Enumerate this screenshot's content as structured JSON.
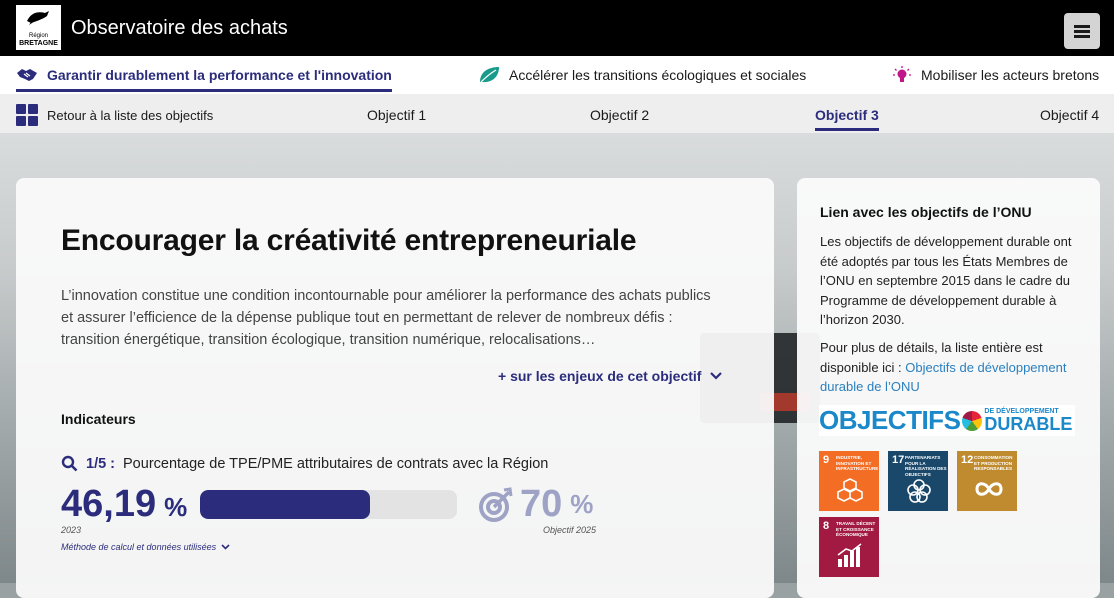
{
  "header": {
    "logo_line1": "Région",
    "logo_line2": "BRETAGNE",
    "title": "Observatoire des achats",
    "menu_icon": "hamburger-icon"
  },
  "axes": [
    {
      "label": "Garantir durablement la performance et l'innovation",
      "icon": "handshake-icon",
      "active": true
    },
    {
      "label": "Accélérer les transitions écologiques et sociales",
      "icon": "leaf-icon",
      "active": false
    },
    {
      "label": "Mobiliser les acteurs bretons",
      "icon": "lightbulb-icon",
      "active": false
    }
  ],
  "objectives_nav": {
    "back_label": "Retour à la liste des objectifs",
    "items": [
      "Objectif 1",
      "Objectif 2",
      "Objectif 3",
      "Objectif 4"
    ],
    "active_index": 2
  },
  "main": {
    "title": "Encourager la créativité entrepreneuriale",
    "intro": "L’innovation constitue une condition incontournable pour améliorer la performance des achats publics et assurer l’efficience de la dépense publique tout en permettant de relever de nombreux défis : transition énergétique, transition écologique, transition numérique, relocalisations…",
    "more_label": "+ sur les enjeux de cet objectif",
    "indicators_title": "Indicateurs",
    "indicator": {
      "index": "1/5 :",
      "label": "Pourcentage de TPE/PME attributaires de contrats avec la Région",
      "value": "46,19",
      "value_unit": "%",
      "value_year": "2023",
      "progress_fraction": 0.66,
      "target_value": "70",
      "target_unit": "%",
      "target_label": "Objectif 2025",
      "method_label": "Méthode de calcul et données utilisées"
    }
  },
  "side": {
    "title": "Lien avec les objectifs de l’ONU",
    "paragraph1": "Les objectifs de développement durable ont été adoptés par tous les États Membres de l’ONU en septembre 2015 dans le cadre du Programme de développement durable à l’horizon 2030.",
    "paragraph2_prefix": "Pour plus de détails, la liste entière est disponible ici :",
    "link_label": "Objectifs de développement durable de l’ONU",
    "sdg_logo": {
      "big": "OBJECTIFS",
      "small_top": "DE DÉVELOPPEMENT",
      "small_bottom": "DURABLE"
    },
    "tiles": [
      {
        "number": "9",
        "text": "INDUSTRIE, INNOVATION ET INFRASTRUCTURE",
        "color": "#f36d25"
      },
      {
        "number": "17",
        "text": "PARTENARIATS POUR LA RÉALISATION DES OBJECTIFS",
        "color": "#19486a"
      },
      {
        "number": "12",
        "text": "CONSOMMATION ET PRODUCTION RESPONSABLES",
        "color": "#bf8b2e"
      },
      {
        "number": "8",
        "text": "TRAVAIL DÉCENT ET CROISSANCE ÉCONOMIQUE",
        "color": "#a21942"
      }
    ]
  },
  "colors": {
    "primary": "#2b2d7c",
    "target": "#9ea3c6",
    "link": "#2a7fbf"
  }
}
